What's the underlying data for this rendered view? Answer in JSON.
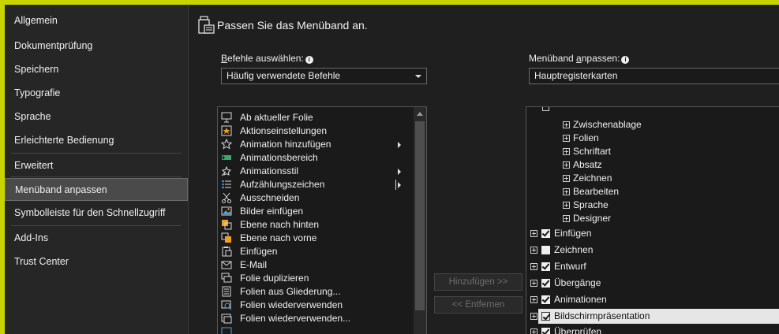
{
  "sidebar": {
    "items": [
      {
        "label": "Allgemein"
      },
      {
        "label": "Dokumentprüfung"
      },
      {
        "label": "Speichern"
      },
      {
        "label": "Typografie"
      },
      {
        "label": "Sprache"
      },
      {
        "label": "Erleichterte Bedienung"
      },
      {
        "label": "Erweitert"
      },
      {
        "label": "Menüband anpassen",
        "active": true
      },
      {
        "label": "Symbolleiste für den Schnellzugriff"
      },
      {
        "label": "Add-Ins"
      },
      {
        "label": "Trust Center"
      }
    ]
  },
  "main": {
    "heading": "Passen Sie das Menüband an.",
    "commands_label_underlined": "B",
    "commands_label_rest": "efehle auswählen:",
    "commands_combo_value": "Häufig verwendete Befehle",
    "ribbon_label_prefix": "Menüband ",
    "ribbon_label_underlined": "a",
    "ribbon_label_rest": "npassen:",
    "ribbon_combo_value": "Hauptregisterkarten",
    "info_glyph": "i",
    "commands": [
      {
        "label": "Ab aktueller Folie",
        "icon": "slideshow-icon"
      },
      {
        "label": "Aktionseinstellungen",
        "icon": "action-icon"
      },
      {
        "label": "Animation hinzufügen",
        "icon": "animation-add-icon",
        "submenu": true
      },
      {
        "label": "Animationsbereich",
        "icon": "animation-pane-icon"
      },
      {
        "label": "Animationsstil",
        "icon": "animation-style-icon",
        "submenu": true
      },
      {
        "label": "Aufzählungszeichen",
        "icon": "bullets-icon",
        "submenu": true,
        "separator": true
      },
      {
        "label": "Ausschneiden",
        "icon": "cut-icon"
      },
      {
        "label": "Bilder einfügen",
        "icon": "pictures-icon"
      },
      {
        "label": "Ebene nach hinten",
        "icon": "send-backward-icon"
      },
      {
        "label": "Ebene nach vorne",
        "icon": "bring-forward-icon"
      },
      {
        "label": "Einfügen",
        "icon": "paste-icon"
      },
      {
        "label": "E-Mail",
        "icon": "email-icon"
      },
      {
        "label": "Folie duplizieren",
        "icon": "duplicate-slide-icon"
      },
      {
        "label": "Folien aus Gliederung...",
        "icon": "outline-slides-icon"
      },
      {
        "label": "Folien wiederverwenden",
        "icon": "reuse-slides-icon"
      },
      {
        "label": "Folien wiederverwenden...",
        "icon": "reuse-slides-icon"
      }
    ],
    "add_button": "Hinzufügen >>",
    "remove_button": "<< Entfernen",
    "tree_groups": [
      {
        "label": "Zwischenablage"
      },
      {
        "label": "Folien"
      },
      {
        "label": "Schriftart"
      },
      {
        "label": "Absatz"
      },
      {
        "label": "Zeichnen"
      },
      {
        "label": "Bearbeiten"
      },
      {
        "label": "Sprache"
      },
      {
        "label": "Designer"
      }
    ],
    "tree_tabs": [
      {
        "label": "Einfügen",
        "checked": true
      },
      {
        "label": "Zeichnen",
        "checked": false
      },
      {
        "label": "Entwurf",
        "checked": true
      },
      {
        "label": "Übergänge",
        "checked": true
      },
      {
        "label": "Animationen",
        "checked": true
      },
      {
        "label": "Bildschirmpräsentation",
        "checked": true,
        "selected": true
      },
      {
        "label": "Überprüfen",
        "checked": true
      }
    ]
  },
  "colors": {
    "accent_border": "#c8d400",
    "panel_bg": "#1f1f1f",
    "sidebar_bg": "#262626",
    "selection_bg": "#e6e6e6"
  }
}
